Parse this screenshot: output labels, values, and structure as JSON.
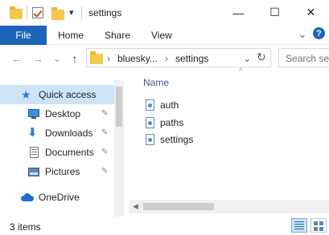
{
  "window": {
    "title": "settings",
    "minimize_glyph": "—",
    "maximize_glyph": "☐",
    "close_glyph": "✕"
  },
  "ribbon": {
    "file_label": "File",
    "tabs": [
      "Home",
      "Share",
      "View"
    ],
    "expand_glyph": "⌄",
    "help_glyph": "?"
  },
  "address": {
    "path": [
      "bluesky...",
      "settings"
    ],
    "separator": "›",
    "refresh_glyph": "↻",
    "dropdown_glyph": "⌄"
  },
  "search": {
    "placeholder": "Search set"
  },
  "nav": {
    "back_glyph": "←",
    "forward_glyph": "→",
    "recent_glyph": "⌄",
    "up_glyph": "↑"
  },
  "sidebar": {
    "items": [
      {
        "label": "Quick access",
        "icon": "star-icon",
        "selected": true
      },
      {
        "label": "Desktop",
        "icon": "desktop-icon",
        "pinned": true
      },
      {
        "label": "Downloads",
        "icon": "download-icon",
        "pinned": true
      },
      {
        "label": "Documents",
        "icon": "documents-icon",
        "pinned": true
      },
      {
        "label": "Pictures",
        "icon": "pictures-icon",
        "pinned": true
      },
      {
        "label": "OneDrive",
        "icon": "cloud-icon"
      }
    ],
    "pin_glyph": "📌"
  },
  "content": {
    "column_header": "Name",
    "sort_glyph": "^",
    "files": [
      {
        "name": "auth"
      },
      {
        "name": "paths"
      },
      {
        "name": "settings"
      }
    ]
  },
  "status": {
    "item_count": "3 items"
  },
  "colors": {
    "accent": "#1c64b8",
    "selection": "#cce4f7",
    "folder": "#f5c84c"
  }
}
